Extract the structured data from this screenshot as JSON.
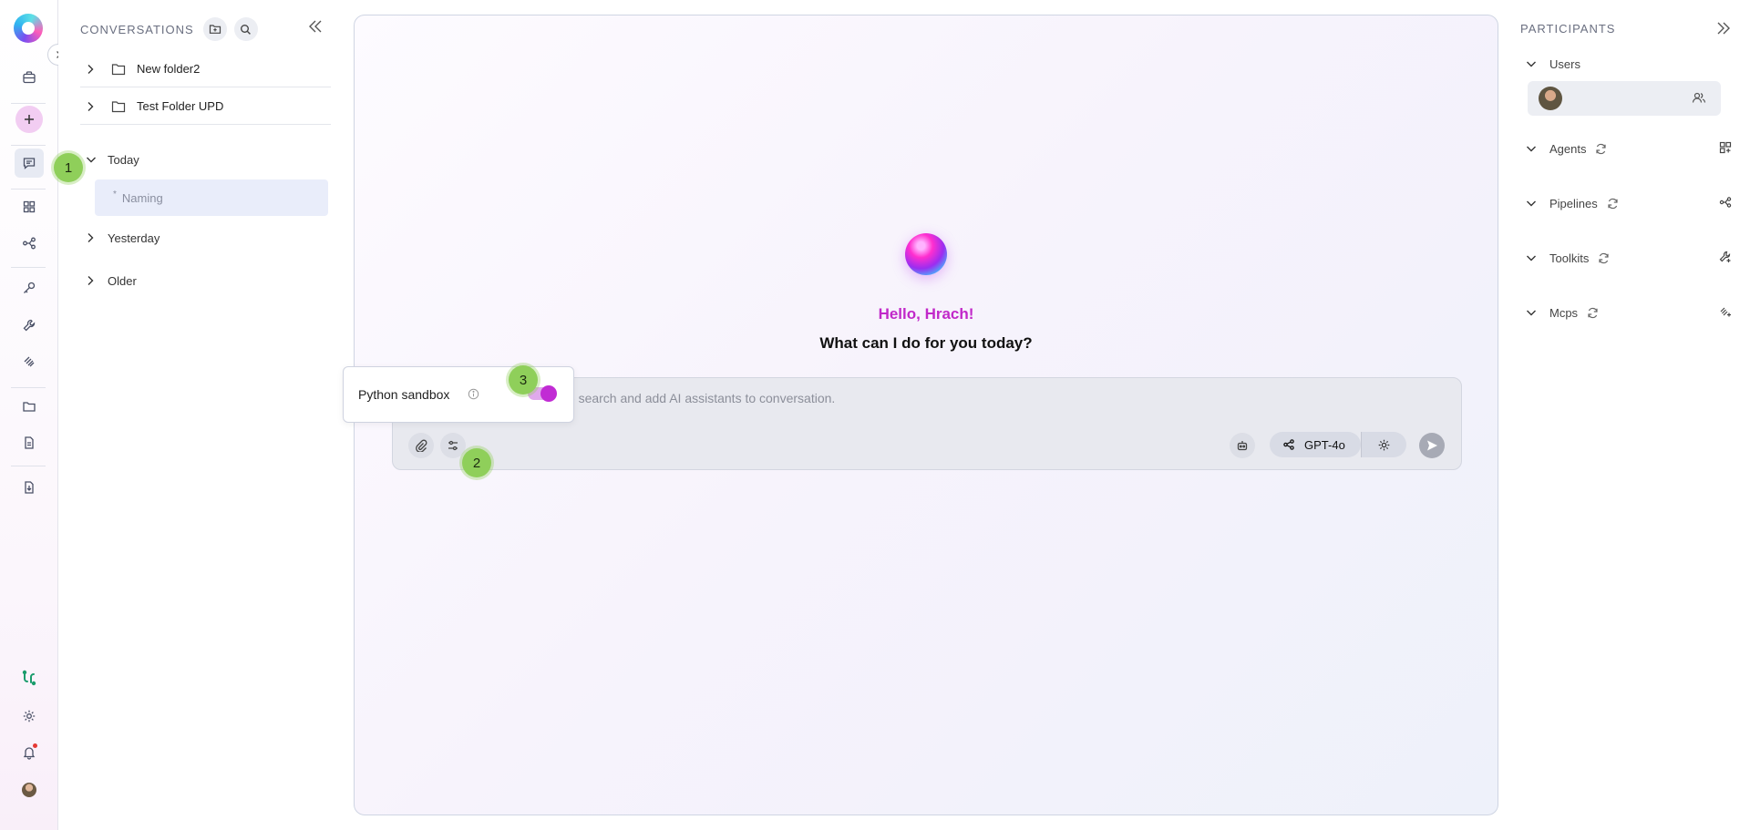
{
  "sidebar": {
    "title": "CONVERSATIONS",
    "folders": [
      {
        "label": "New folder2"
      },
      {
        "label": "Test Folder UPD"
      }
    ],
    "groups": [
      {
        "label": "Today"
      },
      {
        "label": "Yesterday"
      },
      {
        "label": "Older"
      }
    ],
    "active_conversation": {
      "label": "Naming",
      "marker": "*"
    }
  },
  "chat": {
    "greeting": "Hello, Hrach!",
    "question": "What can I do for you today?",
    "input_placeholder": "to search and add AI assistants to conversation.",
    "model_label": "GPT-4o",
    "popover": {
      "label": "Python sandbox",
      "enabled": true
    }
  },
  "badges": [
    "1",
    "2",
    "3"
  ],
  "participants": {
    "title": "PARTICIPANTS",
    "sections": [
      {
        "label": "Users"
      },
      {
        "label": "Agents"
      },
      {
        "label": "Pipelines"
      },
      {
        "label": "Toolkits"
      },
      {
        "label": "Mcps"
      }
    ]
  },
  "colors": {
    "accent": "#c128c9",
    "badge": "#8fcf5a",
    "active_item": "#e9edfa"
  }
}
